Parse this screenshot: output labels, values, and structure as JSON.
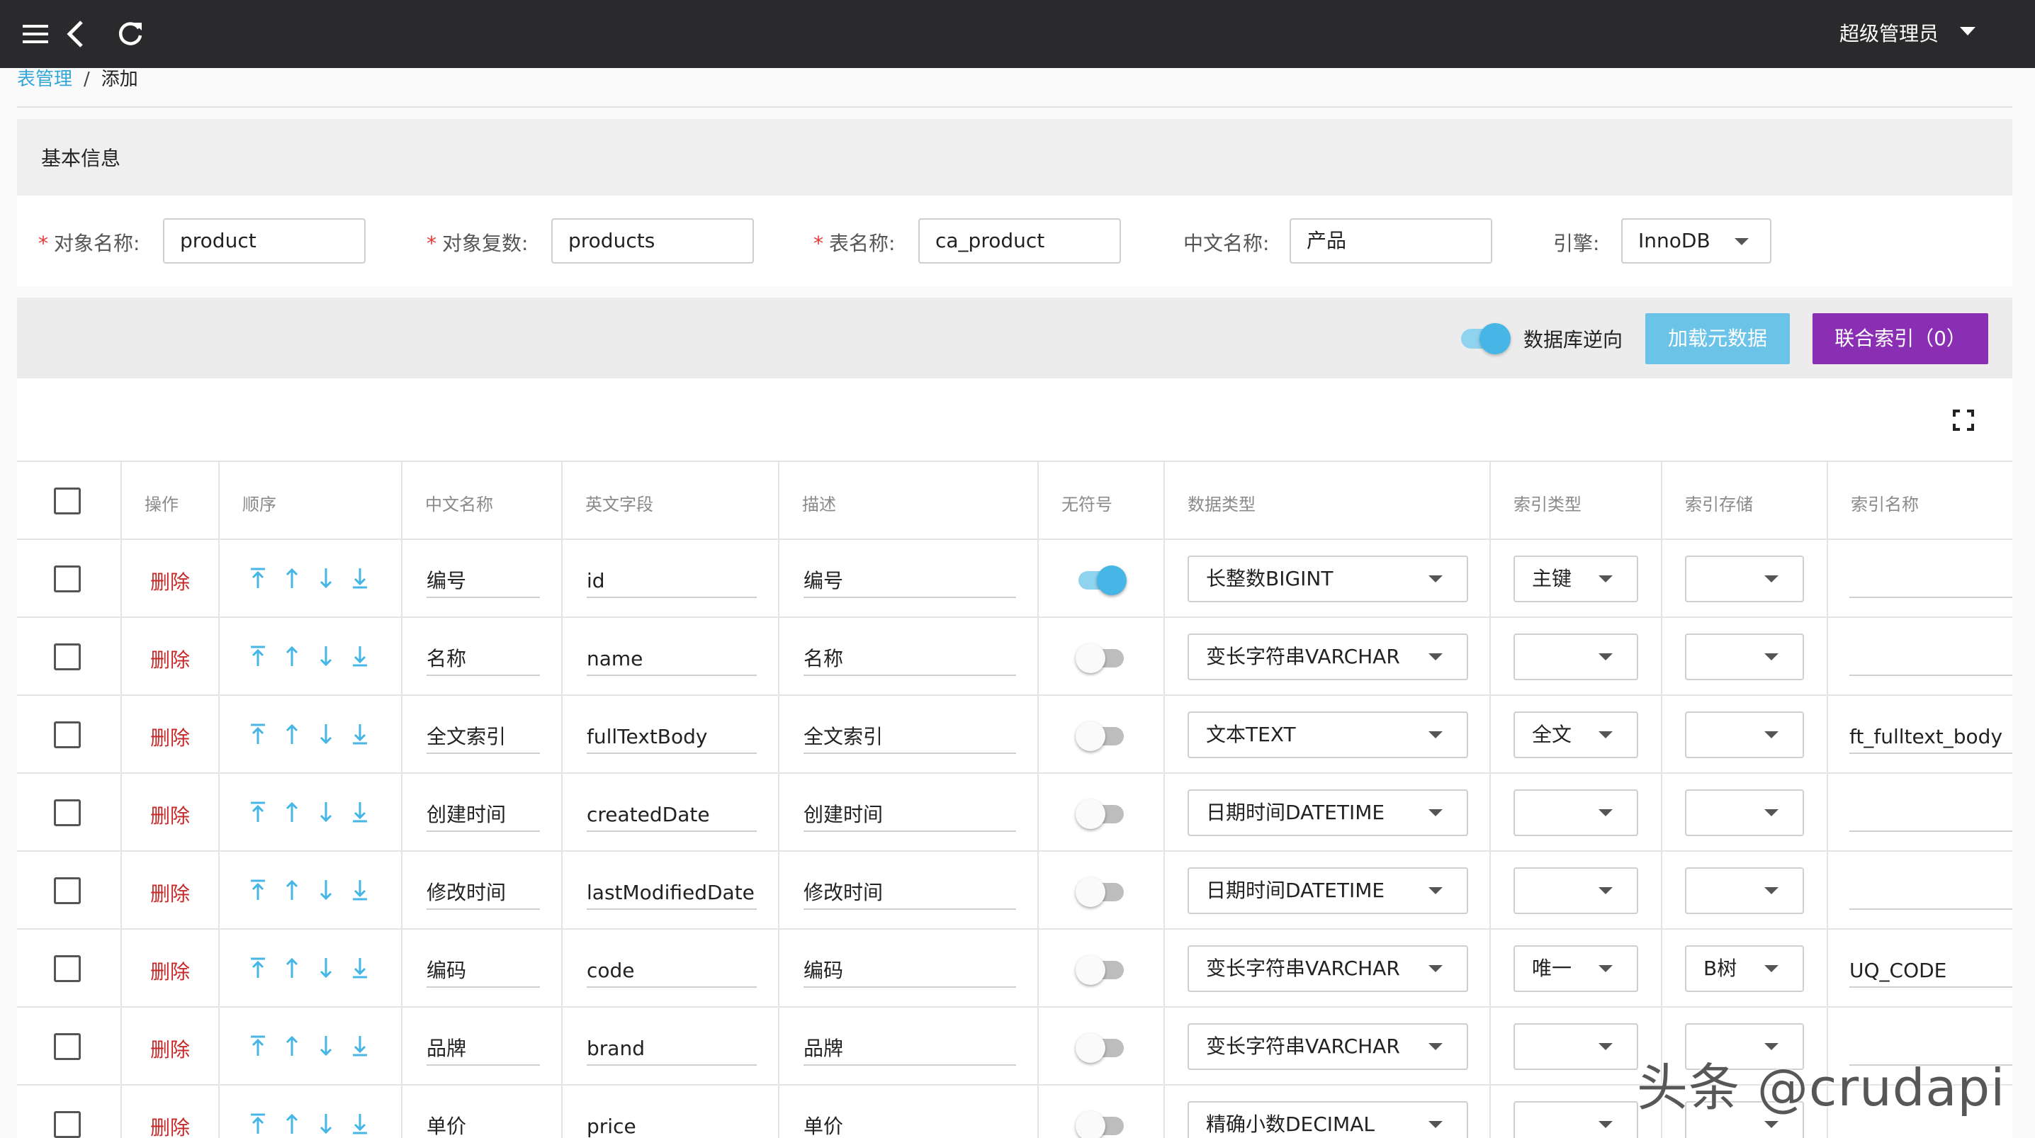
{
  "header": {
    "user": "超级管理员"
  },
  "breadcrumb": {
    "parent": "表管理",
    "separator": "/",
    "current": "添加"
  },
  "basic": {
    "title": "基本信息",
    "fields": {
      "name": {
        "label": "对象名称:",
        "value": "product"
      },
      "plural": {
        "label": "对象复数:",
        "value": "products"
      },
      "table": {
        "label": "表名称:",
        "value": "ca_product"
      },
      "caption": {
        "label": "中文名称:",
        "value": "产品"
      },
      "engine": {
        "label": "引擎:",
        "value": "InnoDB"
      }
    },
    "required_mark": "*"
  },
  "toolbar": {
    "reverse_label": "数据库逆向",
    "reverse_on": true,
    "load_label": "加载元数据",
    "union_label": "联合索引（0）"
  },
  "columns": [
    "操作",
    "顺序",
    "中文名称",
    "英文字段",
    "描述",
    "无符号",
    "数据类型",
    "索引类型",
    "索引存储",
    "索引名称"
  ],
  "rows": [
    {
      "delete": "删除",
      "caption": "编号",
      "name": "id",
      "desc": "编号",
      "unsigned": true,
      "type": "长整数BIGINT",
      "index_type": "主键",
      "index_storage": "",
      "index_name": ""
    },
    {
      "delete": "删除",
      "caption": "名称",
      "name": "name",
      "desc": "名称",
      "unsigned": false,
      "type": "变长字符串VARCHAR",
      "index_type": "",
      "index_storage": "",
      "index_name": ""
    },
    {
      "delete": "删除",
      "caption": "全文索引",
      "name": "fullTextBody",
      "desc": "全文索引",
      "unsigned": false,
      "type": "文本TEXT",
      "index_type": "全文",
      "index_storage": "",
      "index_name": "ft_fulltext_body"
    },
    {
      "delete": "删除",
      "caption": "创建时间",
      "name": "createdDate",
      "desc": "创建时间",
      "unsigned": false,
      "type": "日期时间DATETIME",
      "index_type": "",
      "index_storage": "",
      "index_name": ""
    },
    {
      "delete": "删除",
      "caption": "修改时间",
      "name": "lastModifiedDate",
      "desc": "修改时间",
      "unsigned": false,
      "type": "日期时间DATETIME",
      "index_type": "",
      "index_storage": "",
      "index_name": ""
    },
    {
      "delete": "删除",
      "caption": "编码",
      "name": "code",
      "desc": "编码",
      "unsigned": false,
      "type": "变长字符串VARCHAR",
      "index_type": "唯一",
      "index_storage": "B树",
      "index_name": "UQ_CODE"
    },
    {
      "delete": "删除",
      "caption": "品牌",
      "name": "brand",
      "desc": "品牌",
      "unsigned": false,
      "type": "变长字符串VARCHAR",
      "index_type": "",
      "index_storage": "",
      "index_name": ""
    },
    {
      "delete": "删除",
      "caption": "单价",
      "name": "price",
      "desc": "单价",
      "unsigned": false,
      "type": "精确小数DECIMAL",
      "index_type": "",
      "index_storage": "",
      "index_name": ""
    }
  ],
  "icons": {
    "menu": "menu-icon",
    "back": "back-icon",
    "refresh": "refresh-icon",
    "expand": "fullscreen-icon",
    "order": [
      "move-top-icon",
      "move-up-icon",
      "move-down-icon",
      "move-bottom-icon"
    ]
  },
  "colors": {
    "accent": "#45b6e6",
    "load_button": "#6cc3e8",
    "union_button": "#8a2fb3",
    "delete": "#c62828",
    "topbar": "#2a2a2c"
  },
  "watermark": "头条 @crudapi"
}
